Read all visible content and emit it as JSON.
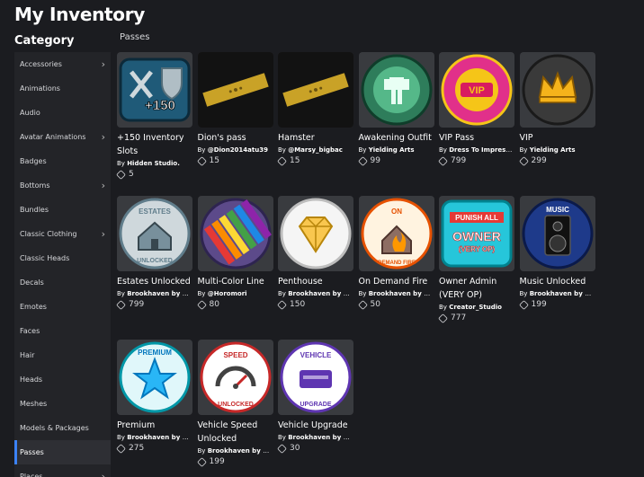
{
  "title": "My Inventory",
  "category_heading": "Category",
  "section": "Passes",
  "categories": [
    {
      "label": "Accessories",
      "chev": "›"
    },
    {
      "label": "Animations",
      "chev": ""
    },
    {
      "label": "Audio",
      "chev": ""
    },
    {
      "label": "Avatar Animations",
      "chev": "›"
    },
    {
      "label": "Badges",
      "chev": ""
    },
    {
      "label": "Bottoms",
      "chev": "›"
    },
    {
      "label": "Bundles",
      "chev": ""
    },
    {
      "label": "Classic Clothing",
      "chev": "›"
    },
    {
      "label": "Classic Heads",
      "chev": ""
    },
    {
      "label": "Decals",
      "chev": ""
    },
    {
      "label": "Emotes",
      "chev": ""
    },
    {
      "label": "Faces",
      "chev": ""
    },
    {
      "label": "Hair",
      "chev": ""
    },
    {
      "label": "Heads",
      "chev": ""
    },
    {
      "label": "Meshes",
      "chev": ""
    },
    {
      "label": "Models & Packages",
      "chev": ""
    },
    {
      "label": "Passes",
      "chev": "",
      "active": true
    },
    {
      "label": "Places",
      "chev": "›"
    }
  ],
  "items": [
    {
      "name": "+150 Inventory Slots",
      "by": "By",
      "creator": "Hidden Studio.",
      "price": "5",
      "icon": "inventory-150-icon"
    },
    {
      "name": "Dion's pass",
      "by": "By",
      "creator": "@Dion2014atu39",
      "price": "15",
      "icon": "gold-ticket-icon"
    },
    {
      "name": "Hamster",
      "by": "By",
      "creator": "@Marsy_bigbac",
      "price": "15",
      "icon": "gold-ticket-icon"
    },
    {
      "name": "Awakening Outfit",
      "by": "By",
      "creator": "Yielding Arts",
      "price": "99",
      "icon": "awakening-aura-icon"
    },
    {
      "name": "VIP Pass",
      "by": "By",
      "creator": "Dress To Impress ...",
      "price": "799",
      "icon": "vip-badge-icon"
    },
    {
      "name": "VIP",
      "by": "By",
      "creator": "Yielding Arts",
      "price": "299",
      "icon": "vip-crown-icon"
    },
    {
      "name": "Estates Unlocked",
      "by": "By",
      "creator": "Brookhaven by V...",
      "price": "799",
      "icon": "estates-house-icon",
      "badge_text": "ESTATES",
      "badge_text2": "UNLOCKED"
    },
    {
      "name": "Multi-Color Line",
      "by": "By",
      "creator": "@Horomori",
      "price": "80",
      "icon": "multicolor-lines-icon"
    },
    {
      "name": "Penthouse",
      "by": "By",
      "creator": "Brookhaven by V...",
      "price": "150",
      "icon": "diamond-icon"
    },
    {
      "name": "On Demand Fire",
      "by": "By",
      "creator": "Brookhaven by V...",
      "price": "50",
      "icon": "house-fire-icon",
      "badge_text": "ON",
      "badge_text2": "DEMAND FIRE"
    },
    {
      "name": "Owner Admin (VERY OP)",
      "by": "By",
      "creator": "Creator_Studio",
      "price": "777",
      "icon": "owner-admin-icon",
      "badge_text": "PUNISH ALL",
      "badge_text2": "OWNER",
      "badge_text3": "(VERY OP)"
    },
    {
      "name": "Music Unlocked",
      "by": "By",
      "creator": "Brookhaven by V...",
      "price": "199",
      "icon": "speaker-icon",
      "badge_text": "MUSIC"
    },
    {
      "name": "Premium",
      "by": "By",
      "creator": "Brookhaven by V...",
      "price": "275",
      "icon": "premium-star-icon",
      "badge_text": "PREMIUM"
    },
    {
      "name": "Vehicle Speed Unlocked",
      "by": "By",
      "creator": "Brookhaven by V...",
      "price": "199",
      "icon": "speedometer-icon",
      "badge_text": "SPEED",
      "badge_text2": "UNLOCKED"
    },
    {
      "name": "Vehicle Upgrade",
      "by": "By",
      "creator": "Brookhaven by V...",
      "price": "30",
      "icon": "vehicle-upgrade-icon",
      "badge_text": "VEHICLE",
      "badge_text2": "UPGRADE"
    }
  ]
}
